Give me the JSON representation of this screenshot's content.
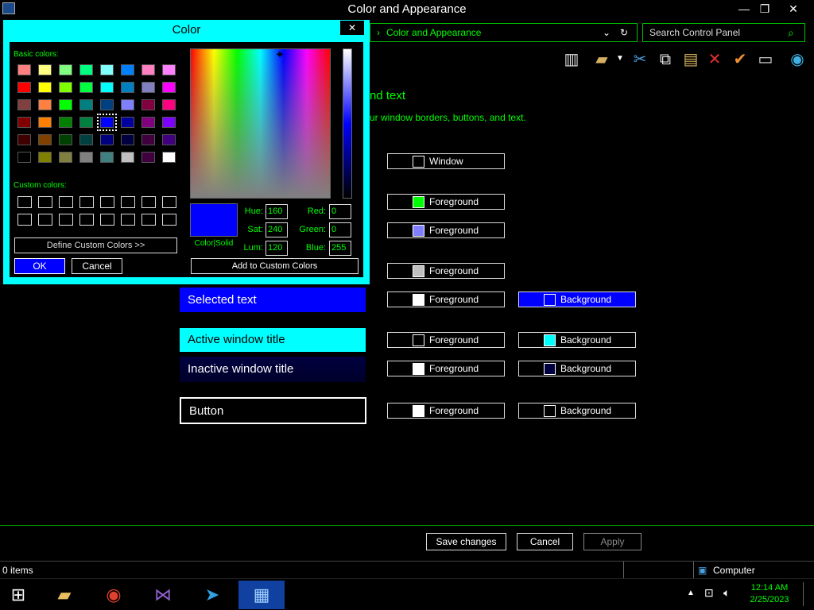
{
  "window": {
    "title": "Color and Appearance",
    "minimize": "—",
    "restore": "❐",
    "close": "✕"
  },
  "address": {
    "path": "Color and Appearance",
    "arrow": "›",
    "dropdown": "⌄",
    "refresh": "↻"
  },
  "search": {
    "placeholder": "Search Control Panel",
    "icon": "⌕"
  },
  "content": {
    "heading_partial": "nd text",
    "desc_partial": "ur window borders, buttons, and text."
  },
  "elements": {
    "selected_text": "Selected text",
    "active_title": "Active window title",
    "inactive_title": "Inactive window title",
    "button": "Button"
  },
  "color_buttons": {
    "window": "Window",
    "foreground": "Foreground",
    "background": "Background"
  },
  "footer": {
    "save": "Save changes",
    "cancel": "Cancel",
    "apply": "Apply"
  },
  "status": {
    "items": "0 items",
    "computer": "Computer"
  },
  "clock": {
    "time": "12:14 AM",
    "date": "2/25/2023"
  },
  "dialog": {
    "title": "Color",
    "close": "✕",
    "basic_colors_label": "Basic colors:",
    "custom_colors_label": "Custom colors:",
    "define_custom": "Define Custom Colors >>",
    "ok": "OK",
    "cancel": "Cancel",
    "color_solid": "Color|Solid",
    "add_custom": "Add to Custom Colors",
    "hue_label": "Hue:",
    "hue": "160",
    "sat_label": "Sat:",
    "sat": "240",
    "lum_label": "Lum:",
    "lum": "120",
    "red_label": "Red:",
    "red": "0",
    "green_label": "Green:",
    "green": "0",
    "blue_label": "Blue:",
    "blue": "255",
    "basic_colors": [
      "#ff8080",
      "#ffff80",
      "#80ff80",
      "#00ff80",
      "#80ffff",
      "#0080ff",
      "#ff80c0",
      "#ff80ff",
      "#ff0000",
      "#ffff00",
      "#80ff00",
      "#00ff40",
      "#00ffff",
      "#0080c0",
      "#8080c0",
      "#ff00ff",
      "#804040",
      "#ff8040",
      "#00ff00",
      "#008080",
      "#004080",
      "#8080ff",
      "#800040",
      "#ff0080",
      "#800000",
      "#ff8000",
      "#008000",
      "#008040",
      "#0000ff",
      "#0000a0",
      "#800080",
      "#8000ff",
      "#400000",
      "#804000",
      "#004000",
      "#004040",
      "#000080",
      "#000040",
      "#400040",
      "#400080",
      "#000000",
      "#808000",
      "#808040",
      "#808080",
      "#408080",
      "#c0c0c0",
      "#400040",
      "#ffffff"
    ],
    "selected_index": 28,
    "current_color": "#0000ff"
  },
  "colors": {
    "accent_green": "#00ff00",
    "dialog_cyan": "#00ffff",
    "selected_blue": "#0000ff",
    "inactive_navy": "#000040"
  }
}
